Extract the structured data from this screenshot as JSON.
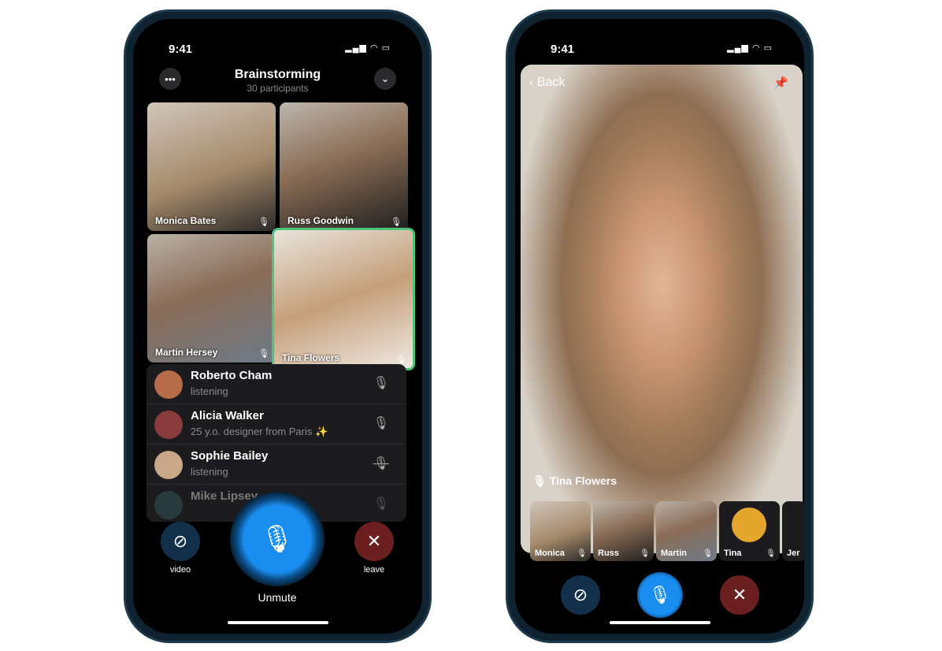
{
  "left_phone": {
    "status_time": "9:41",
    "header": {
      "title": "Brainstorming",
      "subtitle": "30 participants",
      "more_icon": "ellipsis-icon",
      "collapse_icon": "chevron-down-icon"
    },
    "video_tiles": [
      {
        "name": "Monica Bates",
        "mic": "mic-icon"
      },
      {
        "name": "Russ Goodwin",
        "mic": "mic-icon"
      },
      {
        "name": "Martin Hersey",
        "mic": "mic-icon"
      },
      {
        "name": "Tina Flowers",
        "mic": "mic-icon",
        "speaking": true
      }
    ],
    "participants": [
      {
        "name": "Roberto Cham",
        "status": "listening",
        "mic": "mic-icon"
      },
      {
        "name": "Alicia Walker",
        "status": "25 y.o. designer from Paris ✨",
        "mic": "mic-icon"
      },
      {
        "name": "Sophie Bailey",
        "status": "listening",
        "mic": "mic-muted-icon"
      },
      {
        "name": "Mike Lipsey",
        "status": "",
        "mic": "mic-icon"
      }
    ],
    "controls": {
      "video_label": "video",
      "unmute_label": "Unmute",
      "leave_label": "leave"
    },
    "colors": {
      "accent": "#1a8ef0",
      "leave": "#6b1f1f",
      "speaking_border": "#4cc27a"
    }
  },
  "right_phone": {
    "status_time": "9:41",
    "back_label": "Back",
    "pin_icon": "pin-icon",
    "speaker_name": "Tina Flowers",
    "thumbnails": [
      {
        "name": "Monica"
      },
      {
        "name": "Russ"
      },
      {
        "name": "Martin"
      },
      {
        "name": "Tina"
      },
      {
        "name": "Jer"
      }
    ]
  }
}
